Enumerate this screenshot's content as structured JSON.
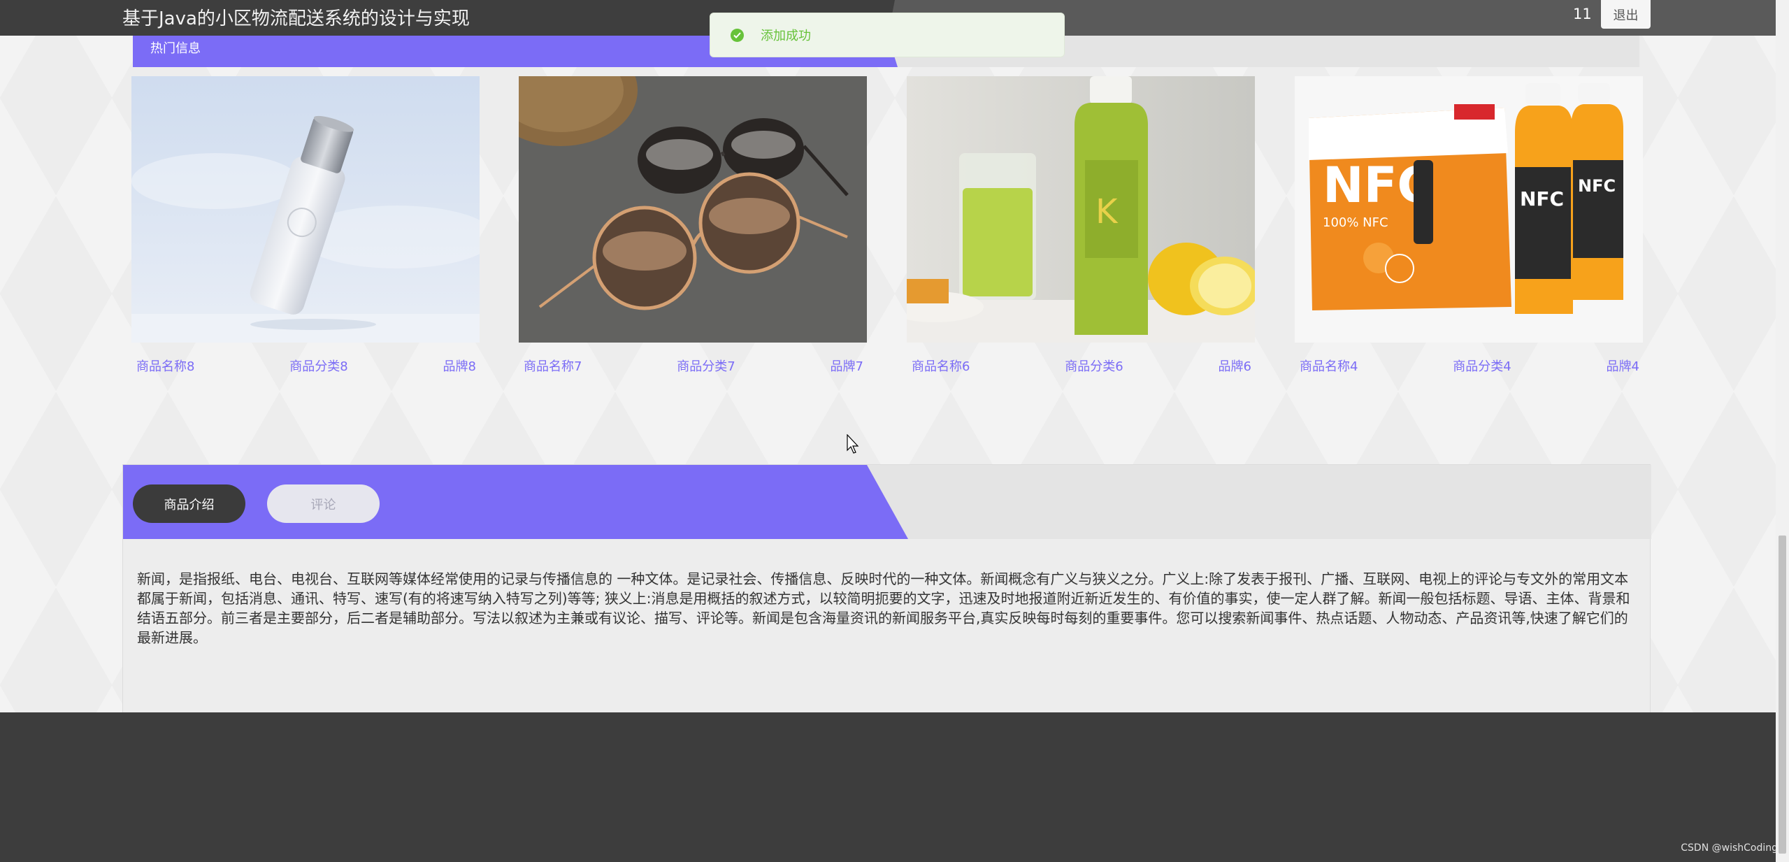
{
  "header": {
    "title": "基于Java的小区物流配送系统的设计与实现",
    "count": "11",
    "logout_label": "退出"
  },
  "toast": {
    "message": "添加成功",
    "icon": "success-check-icon"
  },
  "hot": {
    "title": "热门信息",
    "products": [
      {
        "name": "商品名称8",
        "category": "商品分类8",
        "brand": "品牌8"
      },
      {
        "name": "商品名称7",
        "category": "商品分类7",
        "brand": "品牌7"
      },
      {
        "name": "商品名称6",
        "category": "商品分类6",
        "brand": "品牌6"
      },
      {
        "name": "商品名称4",
        "category": "商品分类4",
        "brand": "品牌4"
      }
    ]
  },
  "detail": {
    "tabs": [
      {
        "label": "商品介绍",
        "active": true
      },
      {
        "label": "评论",
        "active": false
      }
    ],
    "content": "新闻，是指报纸、电台、电视台、互联网等媒体经常使用的记录与传播信息的 一种文体。是记录社会、传播信息、反映时代的一种文体。新闻概念有广义与狭义之分。广义上:除了发表于报刊、广播、互联网、电视上的评论与专文外的常用文本都属于新闻，包括消息、通讯、特写、速写(有的将速写纳入特写之列)等等; 狭义上:消息是用概括的叙述方式，以较简明扼要的文字，迅速及时地报道附近新近发生的、有价值的事实，使一定人群了解。新闻一般包括标题、导语、主体、背景和结语五部分。前三者是主要部分，后二者是辅助部分。写法以叙述为主兼或有议论、描写、评论等。新闻是包含海量资讯的新闻服务平台,真实反映每时每刻的重要事件。您可以搜索新闻事件、热点话题、人物动态、产品资讯等,快速了解它们的最新进展。"
  },
  "watermark": "CSDN @wishCoding",
  "colors": {
    "accent": "#7b6cf6",
    "dark": "#3d3d3d",
    "success": "#67c23a"
  }
}
